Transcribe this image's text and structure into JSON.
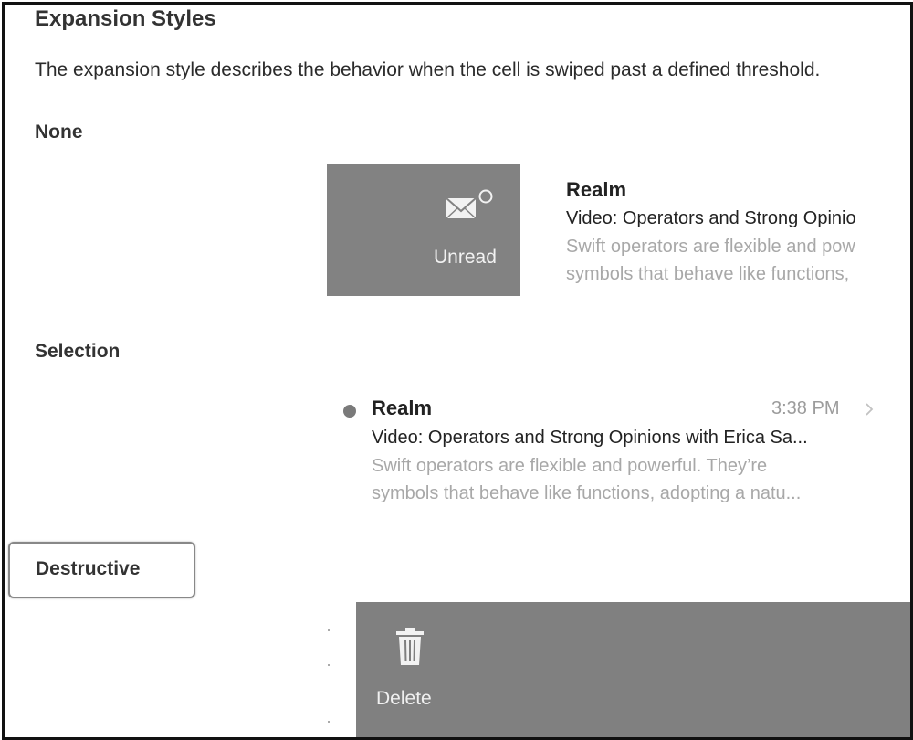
{
  "page": {
    "title": "Expansion Styles",
    "description": "The expansion style describes the behavior when the cell is swiped past a defined threshold."
  },
  "sections": {
    "none": "None",
    "selection": "Selection",
    "destructive": "Destructive"
  },
  "actions": {
    "unread": {
      "label": "Unread",
      "icon": "envelope-unread-icon",
      "color": "#828282"
    },
    "delete": {
      "label": "Delete",
      "icon": "trash-icon",
      "color": "#808080"
    }
  },
  "cells": [
    {
      "sender": "Realm",
      "subject": "Video: Operators and Strong Opinio",
      "preview_line1": "Swift operators are flexible and pow",
      "preview_line2": "symbols that behave like functions,"
    },
    {
      "sender": "Realm",
      "time": "3:38 PM",
      "subject": "Video: Operators and Strong Opinions with Erica Sa...",
      "preview_line1": "Swift operators are flexible and powerful. They’re",
      "preview_line2": "symbols that behave like functions, adopting a natu..."
    }
  ]
}
